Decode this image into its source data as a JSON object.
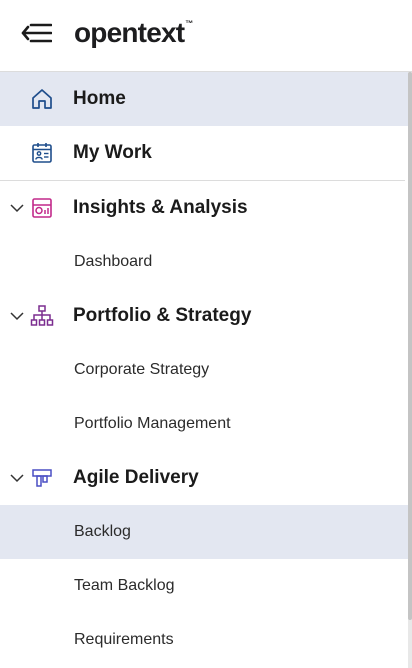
{
  "header": {
    "brand": "opentext",
    "trademark": "™",
    "menu_icon": "collapse-menu-icon"
  },
  "nav": {
    "home": {
      "label": "Home",
      "icon": "home-icon"
    },
    "my_work": {
      "label": "My Work",
      "icon": "calendar-person-icon"
    },
    "insights": {
      "label": "Insights & Analysis",
      "icon": "analytics-icon",
      "color": "#c2298a"
    },
    "dashboard": {
      "label": "Dashboard"
    },
    "portfolio": {
      "label": "Portfolio & Strategy",
      "icon": "hierarchy-icon",
      "color": "#7b2d8f"
    },
    "corporate_strategy": {
      "label": "Corporate Strategy"
    },
    "portfolio_management": {
      "label": "Portfolio Management"
    },
    "agile": {
      "label": "Agile Delivery",
      "icon": "kanban-icon",
      "color": "#4a4fc4"
    },
    "backlog": {
      "label": "Backlog"
    },
    "team_backlog": {
      "label": "Team Backlog"
    },
    "requirements": {
      "label": "Requirements"
    }
  },
  "colors": {
    "active_bg": "#e3e7f1",
    "home_icon": "#1f4e8c",
    "mywork_icon": "#1f4e8c"
  }
}
